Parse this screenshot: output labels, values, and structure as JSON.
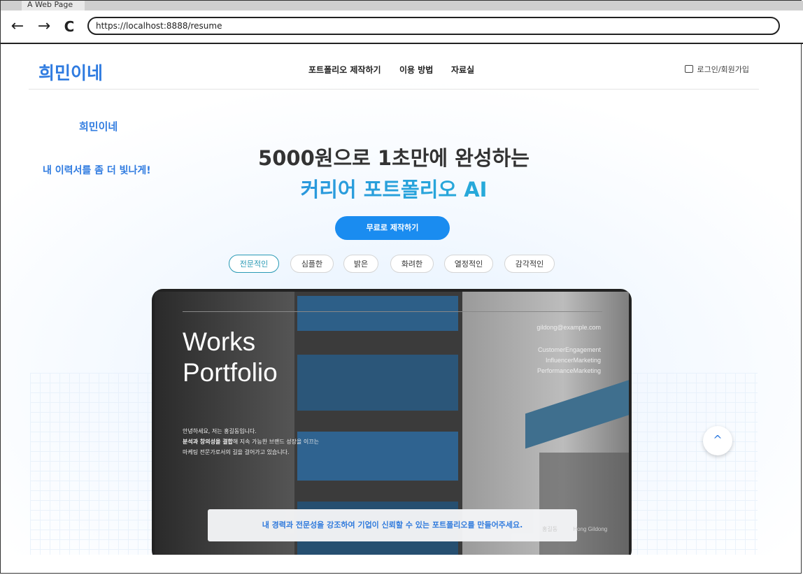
{
  "browser": {
    "tab_title": "A Web Page",
    "back_icon": "←",
    "forward_icon": "→",
    "reload_icon": "C",
    "url": "https://localhost:8888/resume"
  },
  "header": {
    "logo": "희민이네",
    "menu": [
      "포트폴리오 제작하기",
      "이용 방법",
      "자료실"
    ],
    "login": "로그인/회원가입"
  },
  "hero": {
    "side_brand": "희민이네",
    "tagline": "내 이력서를 좀 더 빛나게!",
    "title_line1": "5000원으로 1초만에 완성하는",
    "title_line2": "커리어 포트폴리오 AI",
    "cta": "무료로 제작하기"
  },
  "styles": {
    "items": [
      "전문적인",
      "심플한",
      "밝은",
      "화려한",
      "열정적인",
      "감각적인"
    ],
    "active": "전문적인"
  },
  "preview": {
    "title_line1": "Works",
    "title_line2": "Portfolio",
    "email": "gildong@example.com",
    "tags": [
      "CustomerEngagement",
      "InfluencerMarketing",
      "PerformanceMarketing"
    ],
    "intro_line1": "안녕하세요, 저는 홍길동입니다.",
    "intro_line2_bold": "분석과 창의성을 결합",
    "intro_line2_rest": "해 지속 가능한 브랜드 성장을 이끄는",
    "intro_line3": "마케팅 전문가로서의 길을 걸어가고 있습니다.",
    "name_label": "홍길동",
    "name_en": "Hong Gildong"
  },
  "toast": {
    "message": "내 경력과 전문성을 강조하여 기업이 신뢰할 수 있는 포트폴리오를 만들어주세요."
  },
  "scroll_top_icon": "^",
  "colors": {
    "brand": "#2f7be0",
    "cta": "#1a8cf0",
    "accent_teal": "#2a9ab5"
  }
}
